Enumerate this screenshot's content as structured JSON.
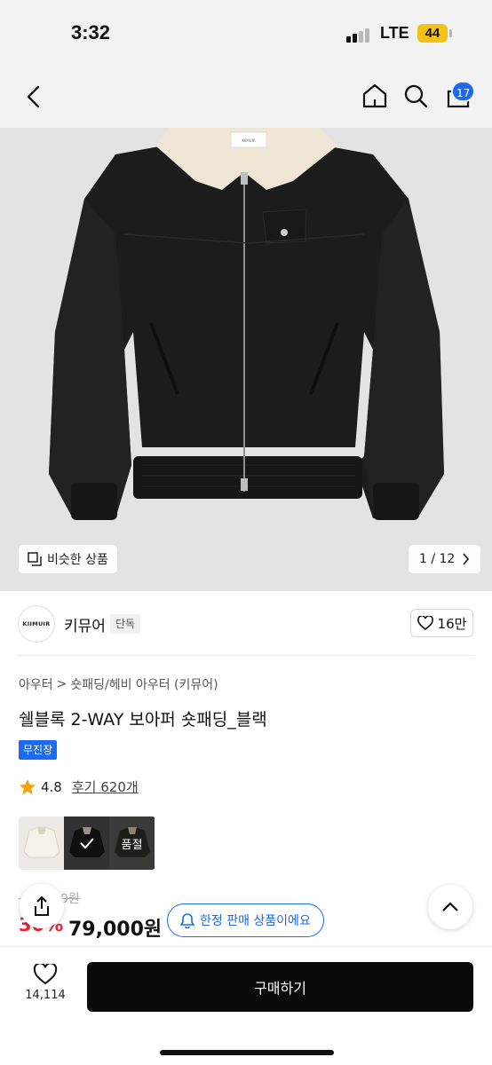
{
  "status_bar": {
    "time": "3:32",
    "network": "LTE",
    "battery": "44"
  },
  "nav": {
    "back_icon": "chevron-left-icon",
    "home_icon": "home-icon",
    "search_icon": "search-icon",
    "cart_icon": "shopping-bag-icon",
    "cart_count": "17"
  },
  "gallery": {
    "similar_label": "비슷한 상품",
    "page_indicator": "1 / 12",
    "image_brand_text": "KIIMUIR"
  },
  "brand": {
    "logo_text": "KIIMUIR",
    "name": "키뮤어",
    "tag": "단독",
    "likes": "16만"
  },
  "product": {
    "breadcrumb": [
      "아우터",
      "숏패딩/헤비 아우터 (키뮤어)"
    ],
    "title": "쉘블록 2-WAY 보아퍼 숏패딩_블랙",
    "badge": "무진장",
    "rating": "4.8",
    "review_label": "후기 620개"
  },
  "options": {
    "sold_out_label": "품절"
  },
  "price": {
    "original": "~~~~0원",
    "discount": "30%",
    "sale": "79,000원",
    "limited_label": "한정 판매 상품이에요"
  },
  "bottom": {
    "wish_count": "14,114",
    "buy_label": "구매하기"
  },
  "colors": {
    "accent_blue": "#1a6bf0",
    "discount_red": "#e2293b",
    "buy_black": "#0a0a0a"
  }
}
